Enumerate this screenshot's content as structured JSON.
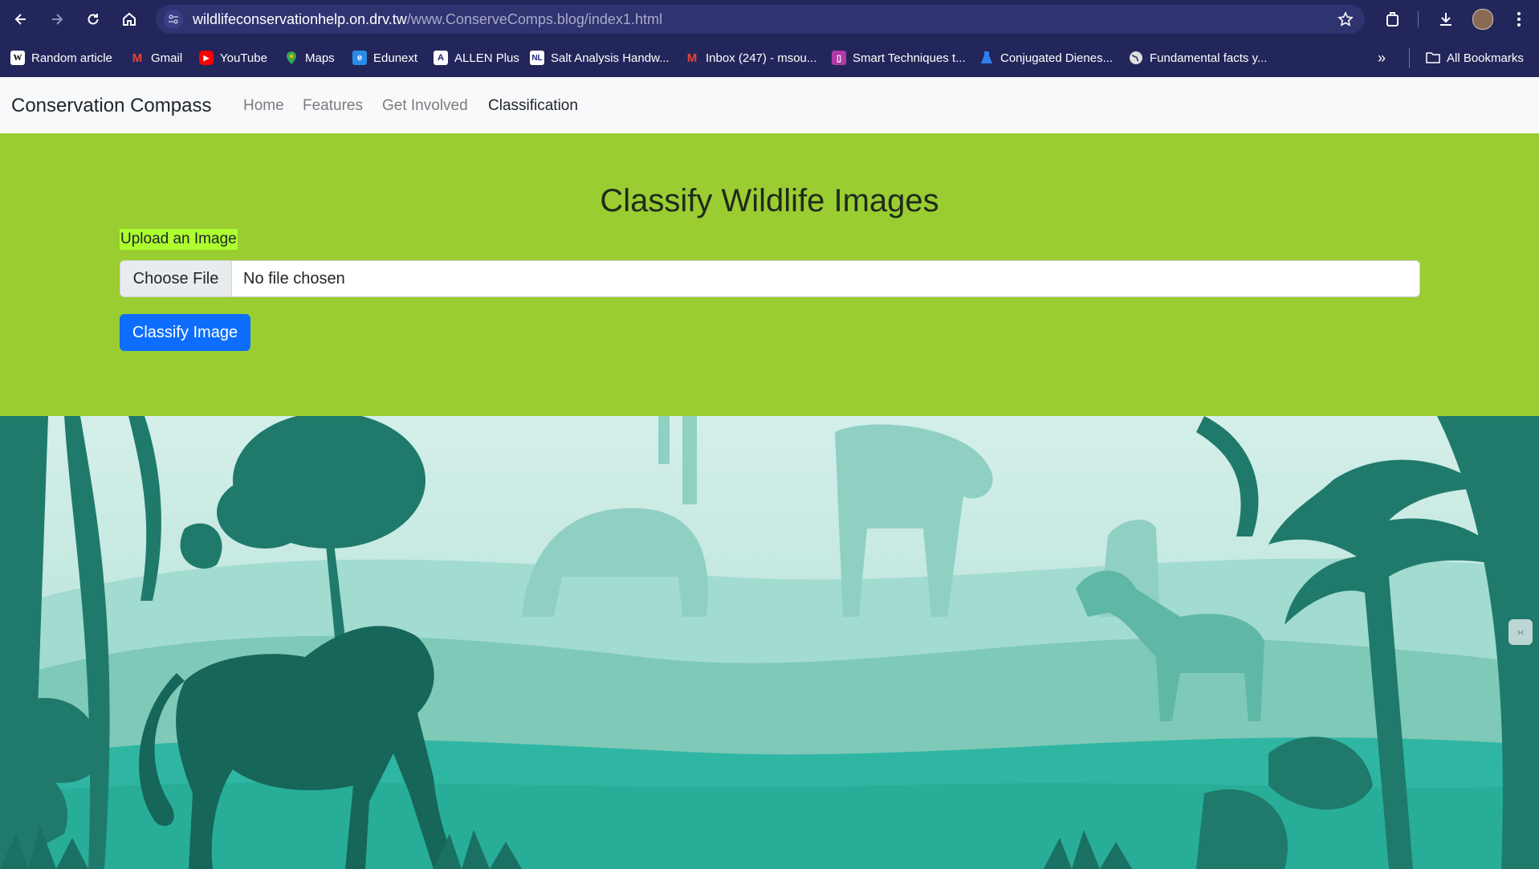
{
  "browser": {
    "url_domain": "wildlifeconservationhelp.on.drv.tw",
    "url_path": "/www.ConserveComps.blog/index1.html",
    "bookmarks": [
      {
        "label": "Random article",
        "icon": "wikipedia-icon",
        "color": "#ffffff"
      },
      {
        "label": "Gmail",
        "icon": "gmail-icon",
        "color": "#ea4335"
      },
      {
        "label": "YouTube",
        "icon": "youtube-icon",
        "color": "#ff0000"
      },
      {
        "label": "Maps",
        "icon": "maps-icon",
        "color": "#34a853"
      },
      {
        "label": "Edunext",
        "icon": "edunext-icon",
        "color": "#2b8ce6"
      },
      {
        "label": "ALLEN Plus",
        "icon": "allen-icon",
        "color": "#ffffff"
      },
      {
        "label": "Salt Analysis Handw...",
        "icon": "nl-icon",
        "color": "#ffffff"
      },
      {
        "label": "Inbox (247) - msou...",
        "icon": "gmail-icon",
        "color": "#ea4335"
      },
      {
        "label": "Smart Techniques t...",
        "icon": "notes-icon",
        "color": "#b03aa6"
      },
      {
        "label": "Conjugated Dienes...",
        "icon": "flask-icon",
        "color": "#2f80ed"
      },
      {
        "label": "Fundamental facts y...",
        "icon": "globe-icon",
        "color": "#e0e0e0"
      }
    ],
    "all_bookmarks": "All Bookmarks"
  },
  "navbar": {
    "brand": "Conservation Compass",
    "links": [
      "Home",
      "Features",
      "Get Involved",
      "Classification"
    ],
    "active": "Classification"
  },
  "hero": {
    "title": "Classify Wildlife Images",
    "upload_label": "Upload an Image",
    "choose_file": "Choose File",
    "file_status": "No file chosen",
    "button": "Classify Image"
  },
  "colors": {
    "hero_bg": "#9acd32",
    "label_highlight": "#adff2f",
    "button": "#0d6efd",
    "chrome": "#23265a"
  }
}
